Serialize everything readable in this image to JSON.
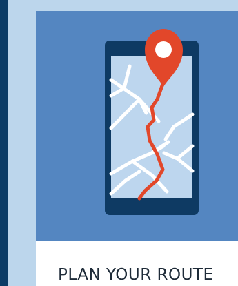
{
  "card": {
    "title": "PLAN YOUR ROUTE"
  },
  "illustration": {
    "icons": [
      "smartphone-icon",
      "map-pin-icon",
      "route-line-icon"
    ],
    "colors": {
      "background": "#bcd6ec",
      "left_strip": "#0b3c66",
      "hero": "#5486c1",
      "phone_body": "#0e3a63",
      "map": "#bdd6ee",
      "roads": "#ffffff",
      "route": "#e2472a",
      "pin": "#e2472a"
    }
  }
}
